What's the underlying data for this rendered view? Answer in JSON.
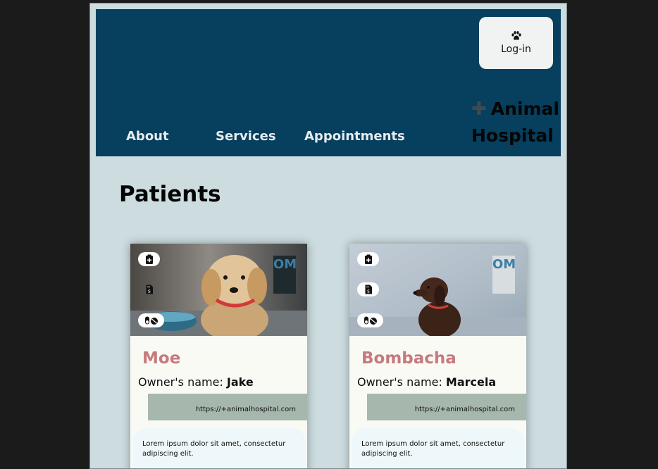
{
  "header": {
    "login_label": "Log-in",
    "brand_name": "Animal Hospital",
    "nav": [
      "About",
      "Services",
      "Appointments"
    ]
  },
  "page_title": "Patients",
  "patients": [
    {
      "name": "Moe",
      "owner_label": "Owner's name: ",
      "owner": "Jake",
      "initials": "OM",
      "website": "https://+animalhospital.com",
      "description": "Lorem ipsum dolor sit amet, consectetur adipiscing elit."
    },
    {
      "name": "Bombacha",
      "owner_label": "Owner's name: ",
      "owner": "Marcela",
      "initials": "OM",
      "website": "https://+animalhospital.com",
      "description": "Lorem ipsum dolor sit amet, consectetur adipiscing elit."
    }
  ],
  "icons": {
    "login": "paw-icon",
    "brand": "plus-icon",
    "card_actions": [
      "medical-clipboard-icon",
      "invoice-icon",
      "pills-icon"
    ]
  },
  "colors": {
    "header_bg": "#073f5e",
    "page_bg": "#ccdcdf",
    "pet_name": "#c57a7e",
    "initials": "#3b7fa5",
    "site_bar": "#a6b7ae"
  }
}
